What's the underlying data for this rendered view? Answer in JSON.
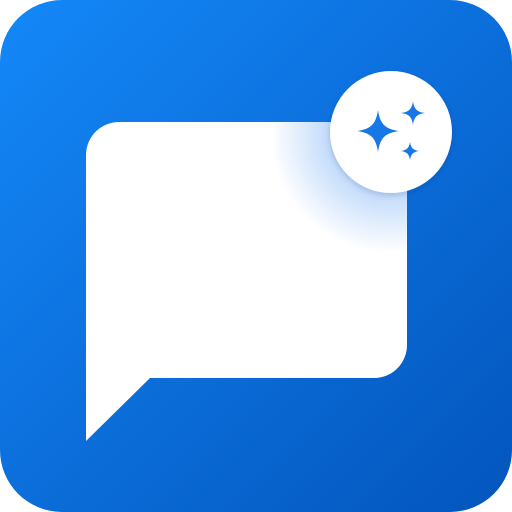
{
  "icon": {
    "name": "chat-sparkle-app-icon",
    "background": {
      "gradient_start": "#1488F8",
      "gradient_end": "#0355BD"
    },
    "bubble_color": "#FFFFFF",
    "glow_color": "#3B8CF0",
    "badge": {
      "fill": "#FFFFFF",
      "sparkle_color": "#1677E6",
      "sparkle_icon": "sparkles-icon"
    }
  }
}
